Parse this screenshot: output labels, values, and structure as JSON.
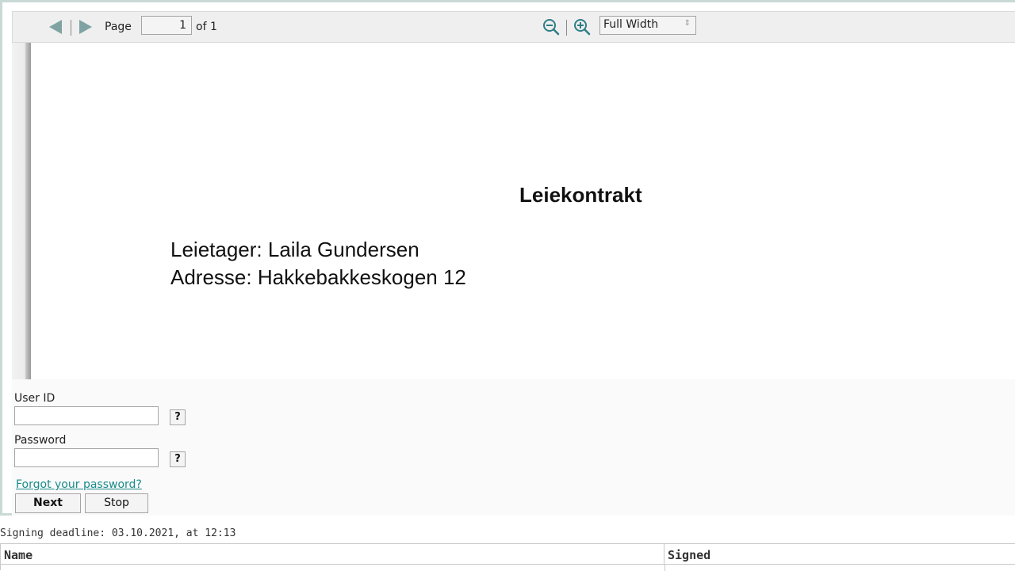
{
  "toolbar": {
    "page_label": "Page",
    "page_value": "1",
    "of_label": "of 1",
    "zoom_value": "Full Width",
    "icons": {
      "prev": "triangle-left-icon",
      "next": "triangle-right-icon",
      "zoom_out": "zoom-out-icon",
      "zoom_in": "zoom-in-icon"
    },
    "colors": {
      "nav_arrow": "#7fa3a3",
      "zoom_icon": "#2e7d86"
    }
  },
  "document": {
    "title": "Leiekontrakt",
    "lines": [
      "Leietager: Laila Gundersen",
      "Adresse: Hakkebakkeskogen 12"
    ]
  },
  "login": {
    "user_id_label": "User ID",
    "user_id_value": "",
    "password_label": "Password",
    "password_value": "",
    "help_label": "?",
    "forgot_link": "Forgot your password?",
    "next_button": "Next",
    "stop_button": "Stop",
    "link_color": "#1a8a8a"
  },
  "signing": {
    "deadline": "Signing deadline: 03.10.2021, at 12:13",
    "columns": [
      "Name",
      "Signed"
    ]
  }
}
